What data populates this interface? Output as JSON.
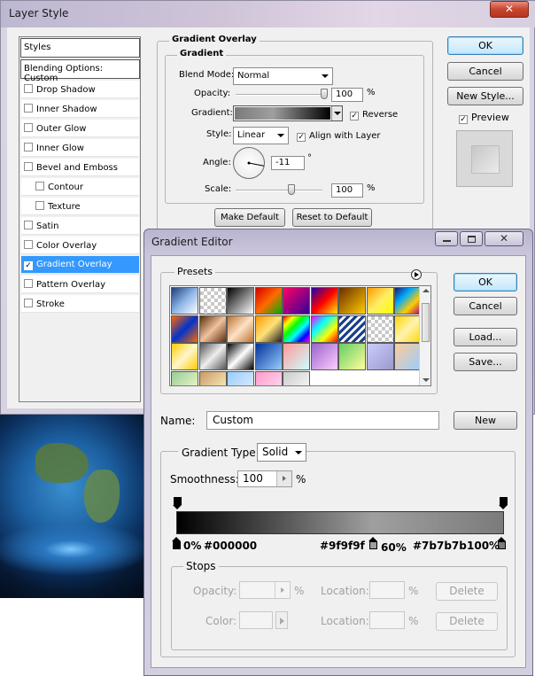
{
  "layer_style": {
    "title": "Layer Style",
    "close_label": "✕",
    "styles_header": "Styles",
    "blending_options": "Blending Options: Custom",
    "items": [
      {
        "label": "Drop Shadow",
        "checked": false
      },
      {
        "label": "Inner Shadow",
        "checked": false
      },
      {
        "label": "Outer Glow",
        "checked": false
      },
      {
        "label": "Inner Glow",
        "checked": false
      },
      {
        "label": "Bevel and Emboss",
        "checked": false
      },
      {
        "label": "Contour",
        "checked": false
      },
      {
        "label": "Texture",
        "checked": false
      },
      {
        "label": "Satin",
        "checked": false
      },
      {
        "label": "Color Overlay",
        "checked": false
      },
      {
        "label": "Gradient Overlay",
        "checked": true
      },
      {
        "label": "Pattern Overlay",
        "checked": false
      },
      {
        "label": "Stroke",
        "checked": false
      }
    ],
    "gradient_overlay": {
      "group_title": "Gradient Overlay",
      "subgroup_title": "Gradient",
      "blend_mode_label": "Blend Mode:",
      "blend_mode_value": "Normal",
      "opacity_label": "Opacity:",
      "opacity_value": "100",
      "opacity_unit": "%",
      "opacity_fraction": 1.0,
      "gradient_label": "Gradient:",
      "reverse_label": "Reverse",
      "reverse_checked": true,
      "style_label": "Style:",
      "style_value": "Linear",
      "align_label": "Align with Layer",
      "align_checked": true,
      "angle_label": "Angle:",
      "angle_value": "-11",
      "angle_unit": "°",
      "scale_label": "Scale:",
      "scale_value": "100",
      "scale_unit": "%",
      "scale_fraction": 0.6,
      "make_default": "Make Default",
      "reset_default": "Reset to Default"
    },
    "buttons": {
      "ok": "OK",
      "cancel": "Cancel",
      "new_style": "New Style...",
      "preview_label": "Preview",
      "preview_checked": true
    }
  },
  "gradient_editor": {
    "title": "Gradient Editor",
    "presets_label": "Presets",
    "buttons": {
      "ok": "OK",
      "cancel": "Cancel",
      "load": "Load...",
      "save": "Save...",
      "new": "New"
    },
    "name_label": "Name:",
    "name_value": "Custom",
    "gradient_type_label": "Gradient Type:",
    "gradient_type_value": "Solid",
    "smoothness_label": "Smoothness:",
    "smoothness_value": "100",
    "smoothness_unit": "%",
    "stops": [
      {
        "location_label": "0%",
        "color_label": "#000000",
        "color": "#000000"
      },
      {
        "location_label": "60%",
        "color_label": "#9f9f9f",
        "color": "#9f9f9f"
      },
      {
        "location_label": "100%",
        "color_label": "#7b7b7b",
        "color": "#7b7b7b"
      }
    ],
    "stops_group": {
      "title": "Stops",
      "opacity_label": "Opacity:",
      "opacity_unit": "%",
      "location_label": "Location:",
      "location_unit": "%",
      "color_label": "Color:",
      "delete_label": "Delete"
    }
  }
}
